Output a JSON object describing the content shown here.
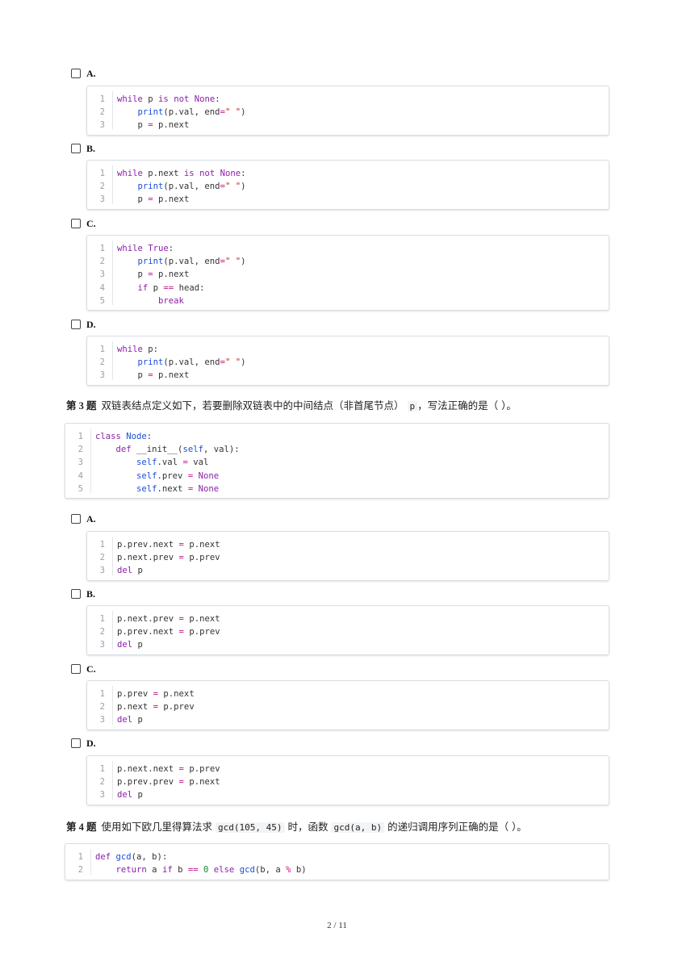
{
  "q2_options": [
    {
      "label": "A.",
      "lines": [
        "while p is not None:",
        "    print(p.val, end=\" \")",
        "    p = p.next"
      ]
    },
    {
      "label": "B.",
      "lines": [
        "while p.next is not None:",
        "    print(p.val, end=\" \")",
        "    p = p.next"
      ]
    },
    {
      "label": "C.",
      "lines": [
        "while True:",
        "    print(p.val, end=\" \")",
        "    p = p.next",
        "    if p == head:",
        "        break"
      ]
    },
    {
      "label": "D.",
      "lines": [
        "while p:",
        "    print(p.val, end=\" \")",
        "    p = p.next"
      ]
    }
  ],
  "q3": {
    "num": "第 3 题",
    "text_before": "双链表结点定义如下，若要删除双链表中的中间结点（非首尾节点）",
    "code_inline": "p",
    "text_after": "，写法正确的是（ ）。",
    "code": [
      "class Node:",
      "    def __init__(self, val):",
      "        self.val = val",
      "        self.prev = None",
      "        self.next = None"
    ],
    "options": [
      {
        "label": "A.",
        "lines": [
          "p.prev.next = p.next",
          "p.next.prev = p.prev",
          "del p"
        ]
      },
      {
        "label": "B.",
        "lines": [
          "p.next.prev = p.next",
          "p.prev.next = p.prev",
          "del p"
        ]
      },
      {
        "label": "C.",
        "lines": [
          "p.prev = p.next",
          "p.next = p.prev",
          "del p"
        ]
      },
      {
        "label": "D.",
        "lines": [
          "p.next.next = p.prev",
          "p.prev.prev = p.next",
          "del p"
        ]
      }
    ]
  },
  "q4": {
    "num": "第 4 题",
    "text_1": "使用如下欧几里得算法求",
    "code_1": "gcd(105, 45)",
    "text_2": "时，函数",
    "code_2": "gcd(a, b)",
    "text_3": "的递归调用序列正确的是（ ）。",
    "code": [
      "def gcd(a, b):",
      "    return a if b == 0 else gcd(b, a % b)"
    ]
  },
  "footer": {
    "page": "2 / 11"
  }
}
